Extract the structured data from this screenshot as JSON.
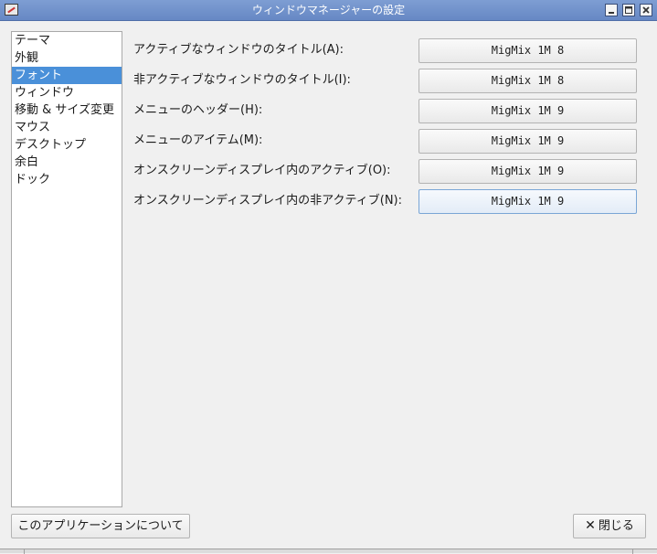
{
  "window": {
    "title": "ウィンドウマネージャーの設定",
    "icon": "settings-app-icon",
    "controls": [
      "minimize-icon",
      "maximize-icon",
      "close-icon"
    ]
  },
  "sidebar": {
    "items": [
      {
        "label": "テーマ",
        "selected": false
      },
      {
        "label": "外観",
        "selected": false
      },
      {
        "label": "フォント",
        "selected": true
      },
      {
        "label": "ウィンドウ",
        "selected": false
      },
      {
        "label": "移動 & サイズ変更",
        "selected": false
      },
      {
        "label": "マウス",
        "selected": false
      },
      {
        "label": "デスクトップ",
        "selected": false
      },
      {
        "label": "余白",
        "selected": false
      },
      {
        "label": "ドック",
        "selected": false
      }
    ]
  },
  "fonts": {
    "rows": [
      {
        "label": "アクティブなウィンドウのタイトル(A):",
        "value": "MigMix 1M 8"
      },
      {
        "label": "非アクティブなウィンドウのタイトル(I):",
        "value": "MigMix 1M 8"
      },
      {
        "label": "メニューのヘッダー(H):",
        "value": "MigMix 1M 9"
      },
      {
        "label": "メニューのアイテム(M):",
        "value": "MigMix 1M 9"
      },
      {
        "label": "オンスクリーンディスプレイ内のアクティブ(O):",
        "value": "MigMix 1M 9"
      },
      {
        "label": "オンスクリーンディスプレイ内の非アクティブ(N):",
        "value": "MigMix 1M 9"
      }
    ]
  },
  "footer": {
    "about_label": "このアプリケーションについて",
    "close_label": "閉じる",
    "close_icon": "x-icon"
  }
}
